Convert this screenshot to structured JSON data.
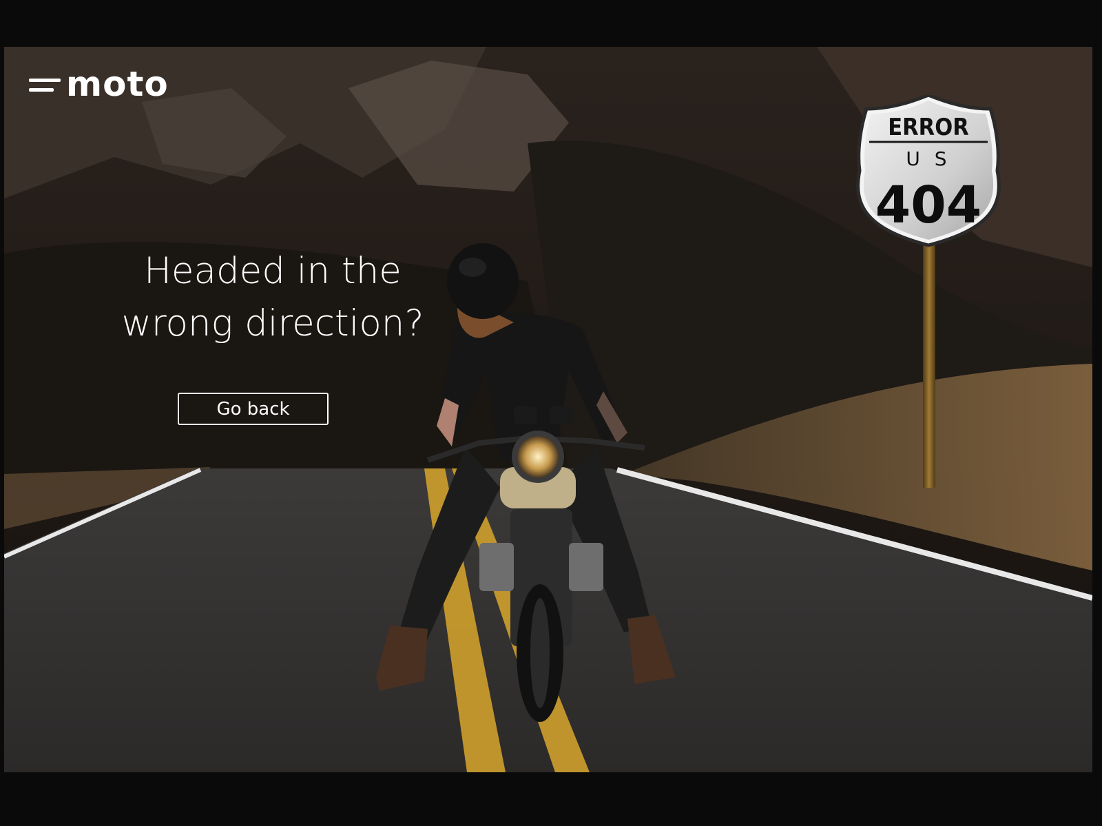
{
  "brand": {
    "name": "moto"
  },
  "hero": {
    "headline_line1": "Headed in the",
    "headline_line2": "wrong direction?",
    "button_label": "Go back"
  },
  "sign": {
    "top": "ERROR",
    "middle": "U S",
    "code": "404"
  },
  "colors": {
    "background": "#0a0a0a",
    "text": "#ffffff",
    "road": "#3a3836",
    "road_line": "#d9a82a",
    "sign_face": "#d8d8d8",
    "sign_post": "#7a5a22"
  },
  "icons": {
    "logo": "menu-lines-icon",
    "scene": "motorcycle-rider-photo"
  }
}
